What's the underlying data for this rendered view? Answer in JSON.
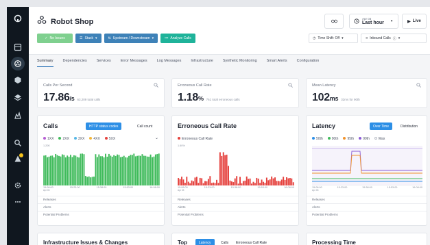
{
  "app": {
    "title": "Robot Shop"
  },
  "header": {
    "time_small": "Apr 03",
    "time_big": "Last hour",
    "live_label": "Live"
  },
  "filters": [
    {
      "label": "No Issues",
      "style": "green"
    },
    {
      "label": "Stack",
      "style": "blue"
    },
    {
      "label": "Upstream / Downstream",
      "style": "blue"
    },
    {
      "label": "Analyze Calls",
      "style": "teal"
    }
  ],
  "controls": {
    "timeshift": "Time Shift: Off",
    "inbound": "Inbound Calls"
  },
  "tabs": [
    "Summary",
    "Dependencies",
    "Services",
    "Error Messages",
    "Log Messages",
    "Infrastructure",
    "Synthetic Monitoring",
    "Smart Alerts",
    "Configuration"
  ],
  "active_tab": "Summary",
  "metrics": [
    {
      "label": "Calls Per Second",
      "value": "17.86",
      "unit": "/s",
      "sub": "63,209 total calls"
    },
    {
      "label": "Erroneous Call Rate",
      "value": "1.18",
      "unit": "%",
      "sub": "761 total erroneous calls"
    },
    {
      "label": "Mean Latency",
      "value": "102",
      "unit": "ms",
      "sub": "32ms for 90th"
    }
  ],
  "charts": {
    "calls": {
      "title": "Calls",
      "toggle_on": "HTTP status codes",
      "toggle_off": "Call count",
      "ymax_label": "1.20K",
      "legend": [
        {
          "label": "1XX",
          "color": "#b65fd3"
        },
        {
          "label": "2XX",
          "color": "#3fbb5b"
        },
        {
          "label": "3XX",
          "color": "#56b7e6"
        },
        {
          "label": "4XX",
          "color": "#f3b63b"
        },
        {
          "label": "5XX",
          "color": "#e5413d"
        }
      ],
      "x_ticks": [
        {
          "t": "15:08:00",
          "s": "Apr 03"
        },
        {
          "t": "15:23:00",
          "s": ""
        },
        {
          "t": "15:38:00",
          "s": ""
        },
        {
          "t": "15:53:00",
          "s": ""
        },
        {
          "t": "16:08:00",
          "s": ""
        }
      ]
    },
    "errors": {
      "title": "Erroneous Call Rate",
      "ymax_label": "1.60%",
      "legend": [
        {
          "label": "Erroneous Call Rate",
          "color": "#e5413d"
        }
      ],
      "x_ticks": [
        {
          "t": "15:08:00",
          "s": "Apr 03"
        },
        {
          "t": "15:23:00",
          "s": ""
        },
        {
          "t": "15:38:00",
          "s": ""
        },
        {
          "t": "15:53:00",
          "s": ""
        },
        {
          "t": "16:08:00",
          "s": ""
        }
      ]
    },
    "latency": {
      "title": "Latency",
      "toggle_on": "Over Time",
      "toggle_off": "Distribution",
      "legend": [
        {
          "label": "50th",
          "color": "#2d8fe6",
          "hollow": false
        },
        {
          "label": "90th",
          "color": "#3fbb5b",
          "hollow": false
        },
        {
          "label": "95th",
          "color": "#f0922b",
          "hollow": false
        },
        {
          "label": "99th",
          "color": "#8a5bd6",
          "hollow": false
        },
        {
          "label": "Max",
          "color": "#b8bdc6",
          "hollow": true
        }
      ],
      "x_ticks": [
        {
          "t": "15:08:00",
          "s": "Apr 03"
        },
        {
          "t": "15:23:00",
          "s": ""
        },
        {
          "t": "15:38:00",
          "s": ""
        },
        {
          "t": "15:53:00",
          "s": ""
        },
        {
          "t": "16:08:00",
          "s": ""
        }
      ]
    }
  },
  "rows": [
    "Releases",
    "Alerts",
    "Potential Problems"
  ],
  "bottom": {
    "infra_title": "Infrastructure Issues & Changes",
    "top_title": "Top",
    "top_tabs": [
      "Latency",
      "Calls",
      "Erroneous Call Rate"
    ],
    "processing_title": "Processing Time"
  },
  "colors": {
    "accent": "#2d8fe6",
    "sidebar": "#10171f",
    "green": "#3fbb5b",
    "red": "#e5413d"
  }
}
